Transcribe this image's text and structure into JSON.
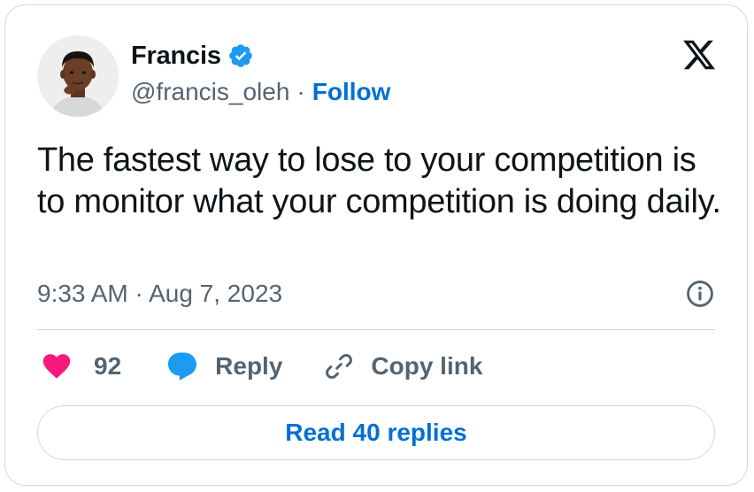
{
  "tweet": {
    "author": {
      "name": "Francis",
      "handle": "@francis_oleh",
      "verified": true,
      "separator": "·",
      "follow_label": "Follow"
    },
    "text": "The fastest way to lose to your competition is to monitor what your competition is doing daily.",
    "timestamp": "9:33 AM · Aug 7, 2023",
    "likes": "92",
    "reply_label": "Reply",
    "copy_link_label": "Copy link",
    "read_replies_label": "Read 40 replies"
  },
  "icons": {
    "logo": "x-logo-icon",
    "verified": "verified-badge-icon",
    "info": "info-icon",
    "like": "heart-icon",
    "reply": "speech-bubble-icon",
    "copy_link": "link-icon"
  },
  "colors": {
    "text_primary": "#0f1419",
    "text_secondary": "#536471",
    "link_blue": "#006fd6",
    "verified_blue": "#1d9bf0",
    "like_pink": "#f91880",
    "border": "#cfd9de"
  }
}
